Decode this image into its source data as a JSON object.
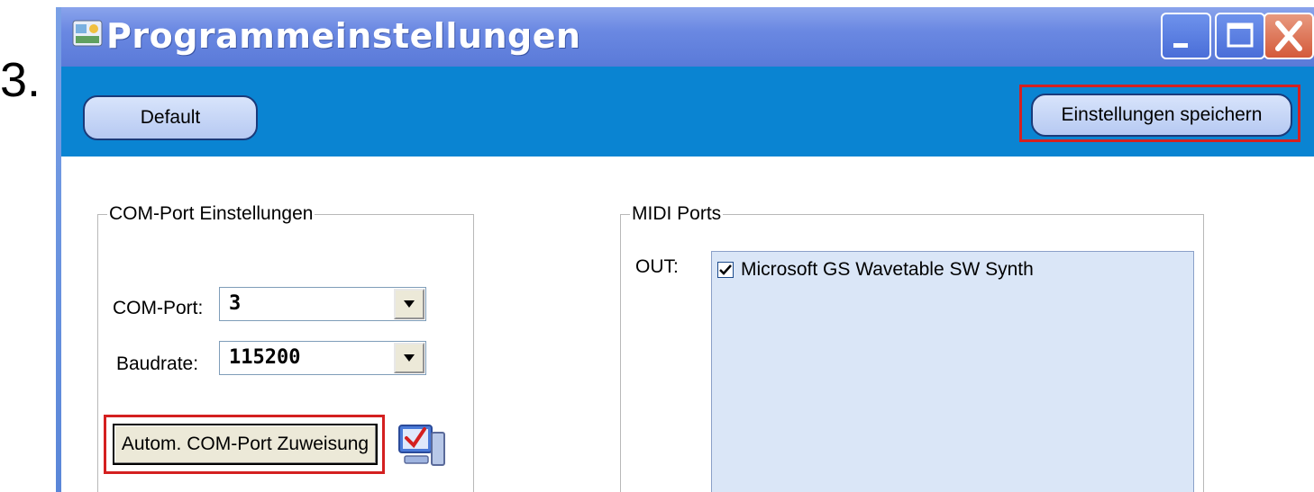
{
  "step_number": "3.",
  "window": {
    "title": "Programmeinstellungen"
  },
  "toolbar": {
    "default_label": "Default",
    "save_label": "Einstellungen speichern"
  },
  "com_port_group": {
    "title": "COM-Port Einstellungen",
    "com_port_label": "COM-Port:",
    "com_port_value": "3",
    "baudrate_label": "Baudrate:",
    "baudrate_value": "115200",
    "auto_assign_label": "Autom. COM-Port Zuweisung"
  },
  "midi_group": {
    "title": "MIDI Ports",
    "out_label": "OUT:",
    "out_devices": [
      {
        "label": "Microsoft GS Wavetable SW Synth",
        "checked": true
      }
    ]
  },
  "colors": {
    "titlebar": "#6a88e2",
    "toolbar": "#0a84d2",
    "highlight": "#d42020",
    "listbox": "#dae6f7"
  }
}
